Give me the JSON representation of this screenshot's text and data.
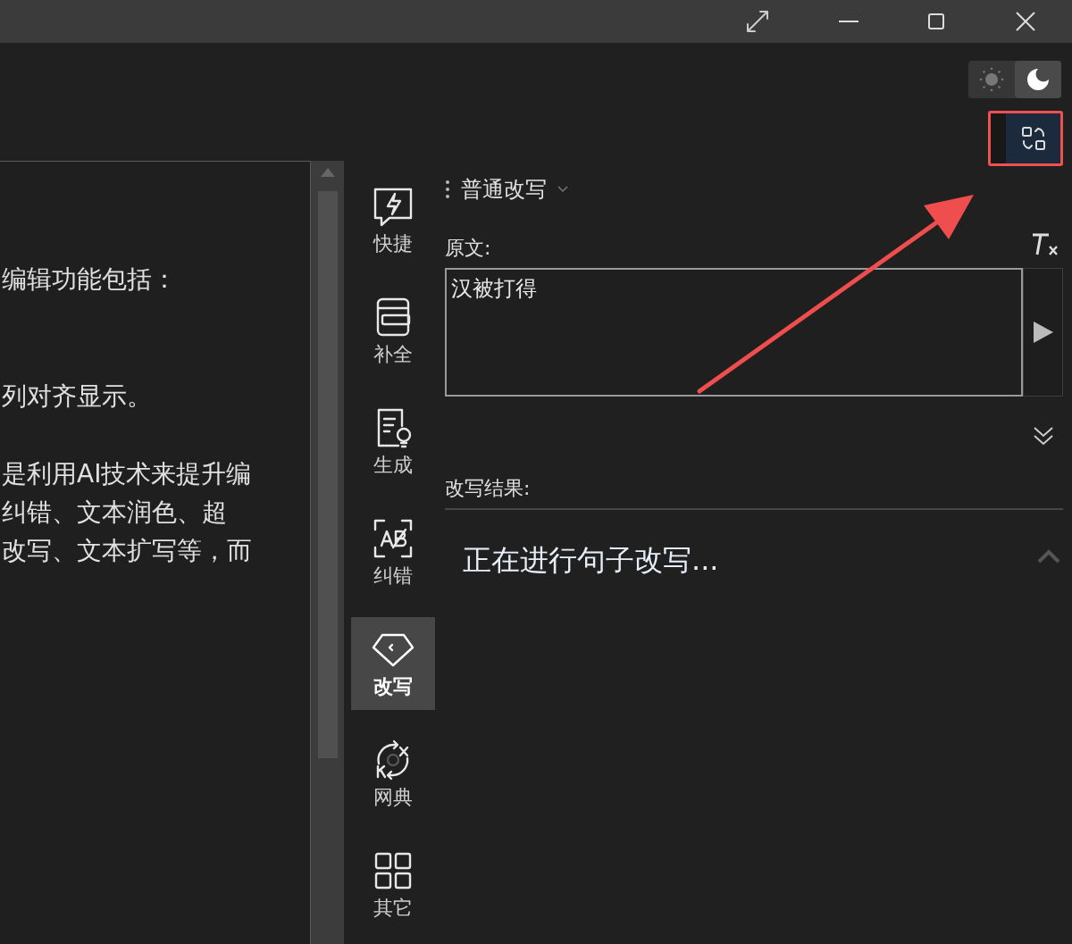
{
  "theme_toggle": [
    {
      "kind": "light",
      "selected": false
    },
    {
      "kind": "dark",
      "selected": true
    }
  ],
  "editor": {
    "paragraphs": [
      [
        "编辑功能包括："
      ],
      [
        "列对齐显示。"
      ],
      [
        "是利用AI技术来提升编",
        "纠错、文本润色、超",
        "改写、文本扩写等，而"
      ]
    ]
  },
  "sidebar": {
    "items": [
      {
        "kind": "quick",
        "label": "快捷",
        "selected": false
      },
      {
        "kind": "complete",
        "label": "补全",
        "selected": false
      },
      {
        "kind": "generate",
        "label": "生成",
        "selected": false
      },
      {
        "kind": "correct",
        "label": "纠错",
        "selected": false
      },
      {
        "kind": "rewrite",
        "label": "改写",
        "selected": true
      },
      {
        "kind": "dictionary",
        "label": "网典",
        "selected": false
      },
      {
        "kind": "other",
        "label": "其它",
        "selected": false
      }
    ]
  },
  "mode_dropdown": {
    "value": "普通改写"
  },
  "source": {
    "label": "原文:",
    "value": "汉被打得"
  },
  "result": {
    "label": "改写结果:",
    "text": "正在进行句子改写..."
  }
}
